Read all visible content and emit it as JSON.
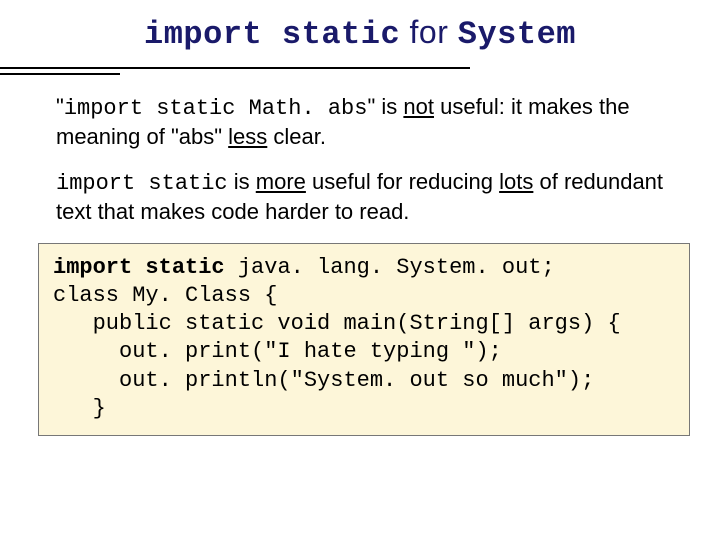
{
  "title": {
    "code": "import static",
    "mid": " for ",
    "code2": "System"
  },
  "para1": {
    "q1": "\"",
    "code": "import static Math. abs",
    "q2": "\" is ",
    "u1": "not",
    "t2": " useful: it makes the meaning of \"abs\" ",
    "u2": "less",
    "t3": " clear."
  },
  "para2": {
    "code": "import static",
    "t1": " is ",
    "u1": "more",
    "t2": " useful for reducing ",
    "u2": "lots",
    "t3": " of redundant text that makes code harder to read."
  },
  "code": {
    "l1a": "import static",
    "l1b": " java. lang. System. out;",
    "l2": "class My. Class {",
    "l3": "   public static void main(String[] args) {",
    "l4": "     out. print(\"I hate typing \");",
    "l5": "     out. println(\"System. out so much\");",
    "l6": "   }"
  }
}
